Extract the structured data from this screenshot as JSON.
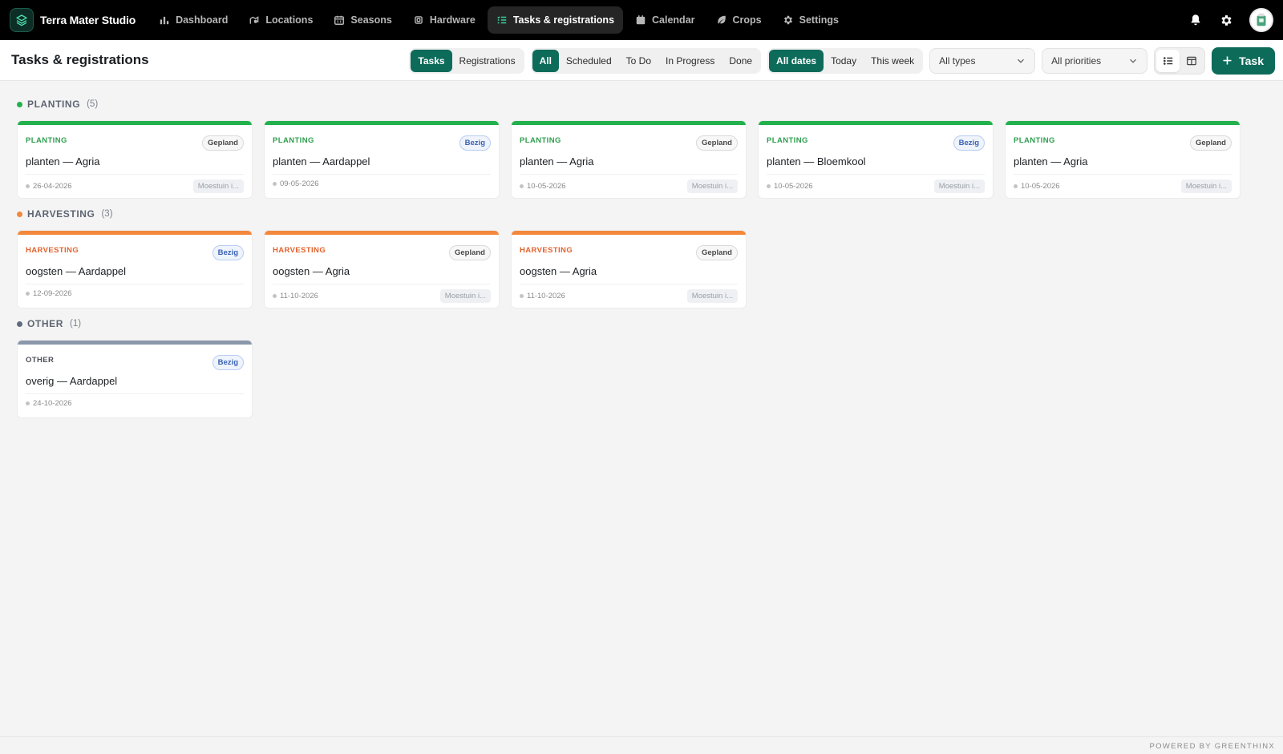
{
  "app": {
    "name": "Terra Mater Studio"
  },
  "nav": [
    {
      "label": "Dashboard",
      "icon": "bar-chart-icon",
      "active": false
    },
    {
      "label": "Locations",
      "icon": "map-pin-icon",
      "active": false
    },
    {
      "label": "Seasons",
      "icon": "calendar-grid-icon",
      "active": false
    },
    {
      "label": "Hardware",
      "icon": "chip-icon",
      "active": false
    },
    {
      "label": "Tasks & registrations",
      "icon": "list-check-icon",
      "active": true
    },
    {
      "label": "Calendar",
      "icon": "calendar-icon",
      "active": false
    },
    {
      "label": "Crops",
      "icon": "leaf-icon",
      "active": false
    },
    {
      "label": "Settings",
      "icon": "gear-icon",
      "active": false
    }
  ],
  "toolbar": {
    "title": "Tasks & registrations",
    "mode_tabs": [
      {
        "label": "Tasks",
        "active": true
      },
      {
        "label": "Registrations",
        "active": false
      }
    ],
    "status_tabs": [
      {
        "label": "All",
        "active": true
      },
      {
        "label": "Scheduled",
        "active": false
      },
      {
        "label": "To Do",
        "active": false
      },
      {
        "label": "In Progress",
        "active": false
      },
      {
        "label": "Done",
        "active": false
      }
    ],
    "date_tabs": [
      {
        "label": "All dates",
        "active": true
      },
      {
        "label": "Today",
        "active": false
      },
      {
        "label": "This week",
        "active": false
      }
    ],
    "type_select": "All types",
    "priority_select": "All priorities",
    "add_label": "Task"
  },
  "colors": {
    "accent": "#0d6b5a",
    "planting": "#22b14c",
    "harvesting": "#f3873b",
    "other": "#8b97aa"
  },
  "sections": [
    {
      "title": "PLANTING",
      "count": "(5)",
      "color": "#22b14c",
      "type_color": "#2e9e4e",
      "cards": [
        {
          "type": "PLANTING",
          "status": "Gepland",
          "title": "planten — Agria",
          "date": "26-04-2026",
          "location": "Moestuin i..."
        },
        {
          "type": "PLANTING",
          "status": "Bezig",
          "title": "planten — Aardappel",
          "date": "09-05-2026",
          "location": ""
        },
        {
          "type": "PLANTING",
          "status": "Gepland",
          "title": "planten — Agria",
          "date": "10-05-2026",
          "location": "Moestuin i..."
        },
        {
          "type": "PLANTING",
          "status": "Bezig",
          "title": "planten — Bloemkool",
          "date": "10-05-2026",
          "location": "Moestuin i..."
        },
        {
          "type": "PLANTING",
          "status": "Gepland",
          "title": "planten — Agria",
          "date": "10-05-2026",
          "location": "Moestuin i..."
        }
      ]
    },
    {
      "title": "HARVESTING",
      "count": "(3)",
      "color": "#f3873b",
      "type_color": "#e2622d",
      "cards": [
        {
          "type": "HARVESTING",
          "status": "Bezig",
          "title": "oogsten — Aardappel",
          "date": "12-09-2026",
          "location": ""
        },
        {
          "type": "HARVESTING",
          "status": "Gepland",
          "title": "oogsten — Agria",
          "date": "11-10-2026",
          "location": "Moestuin i..."
        },
        {
          "type": "HARVESTING",
          "status": "Gepland",
          "title": "oogsten — Agria",
          "date": "11-10-2026",
          "location": "Moestuin i..."
        }
      ]
    },
    {
      "title": "OTHER",
      "count": "(1)",
      "color": "#5f6b7e",
      "bar_color": "#8b97aa",
      "type_color": "#4a4f57",
      "cards": [
        {
          "type": "OTHER",
          "status": "Bezig",
          "title": "overig — Aardappel",
          "date": "24-10-2026",
          "location": ""
        }
      ]
    }
  ],
  "footer": {
    "powered": "POWERED BY GREENTHINX"
  }
}
